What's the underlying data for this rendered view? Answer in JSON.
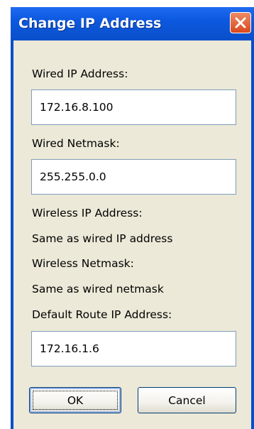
{
  "window": {
    "title": "Change IP Address",
    "close_icon": "close-icon"
  },
  "form": {
    "wired_ip_label": "Wired IP Address:",
    "wired_ip_value": "172.16.8.100",
    "wired_netmask_label": "Wired Netmask:",
    "wired_netmask_value": "255.255.0.0",
    "wireless_ip_label": "Wireless IP Address:",
    "wireless_ip_value": "Same as wired IP address",
    "wireless_netmask_label": "Wireless Netmask:",
    "wireless_netmask_value": "Same as wired netmask",
    "default_route_label": "Default Route IP Address:",
    "default_route_value": "172.16.1.6"
  },
  "buttons": {
    "ok_label": "OK",
    "cancel_label": "Cancel"
  },
  "colors": {
    "titlebar": "#0a4fc9",
    "close_button": "#d9481d",
    "client_background": "#ece9d8"
  }
}
